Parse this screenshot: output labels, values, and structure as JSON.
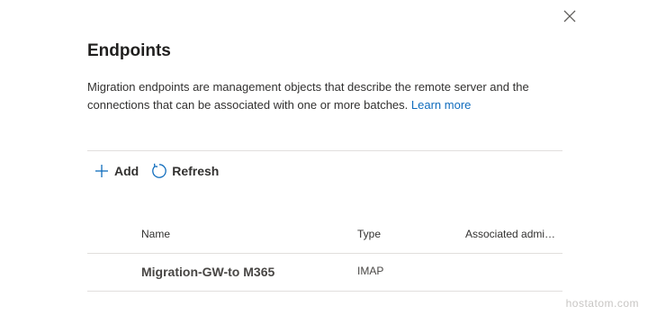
{
  "panel": {
    "title": "Endpoints",
    "description": "Migration endpoints are management objects that describe the remote server and the connections that can be associated with one or more batches.",
    "learn_more_label": "Learn more",
    "close_icon": "close-icon"
  },
  "toolbar": {
    "add_label": "Add",
    "add_icon": "plus-icon",
    "refresh_label": "Refresh",
    "refresh_icon": "refresh-icon"
  },
  "table": {
    "columns": [
      "Name",
      "Type",
      "Associated admi…"
    ],
    "rows": [
      {
        "name": "Migration-GW-to M365",
        "type": "IMAP",
        "associated_admin": ""
      }
    ]
  },
  "watermark": "hostatom.com",
  "colors": {
    "accent": "#0f6cbd",
    "text": "#323130",
    "divider": "#e1dfdd"
  }
}
